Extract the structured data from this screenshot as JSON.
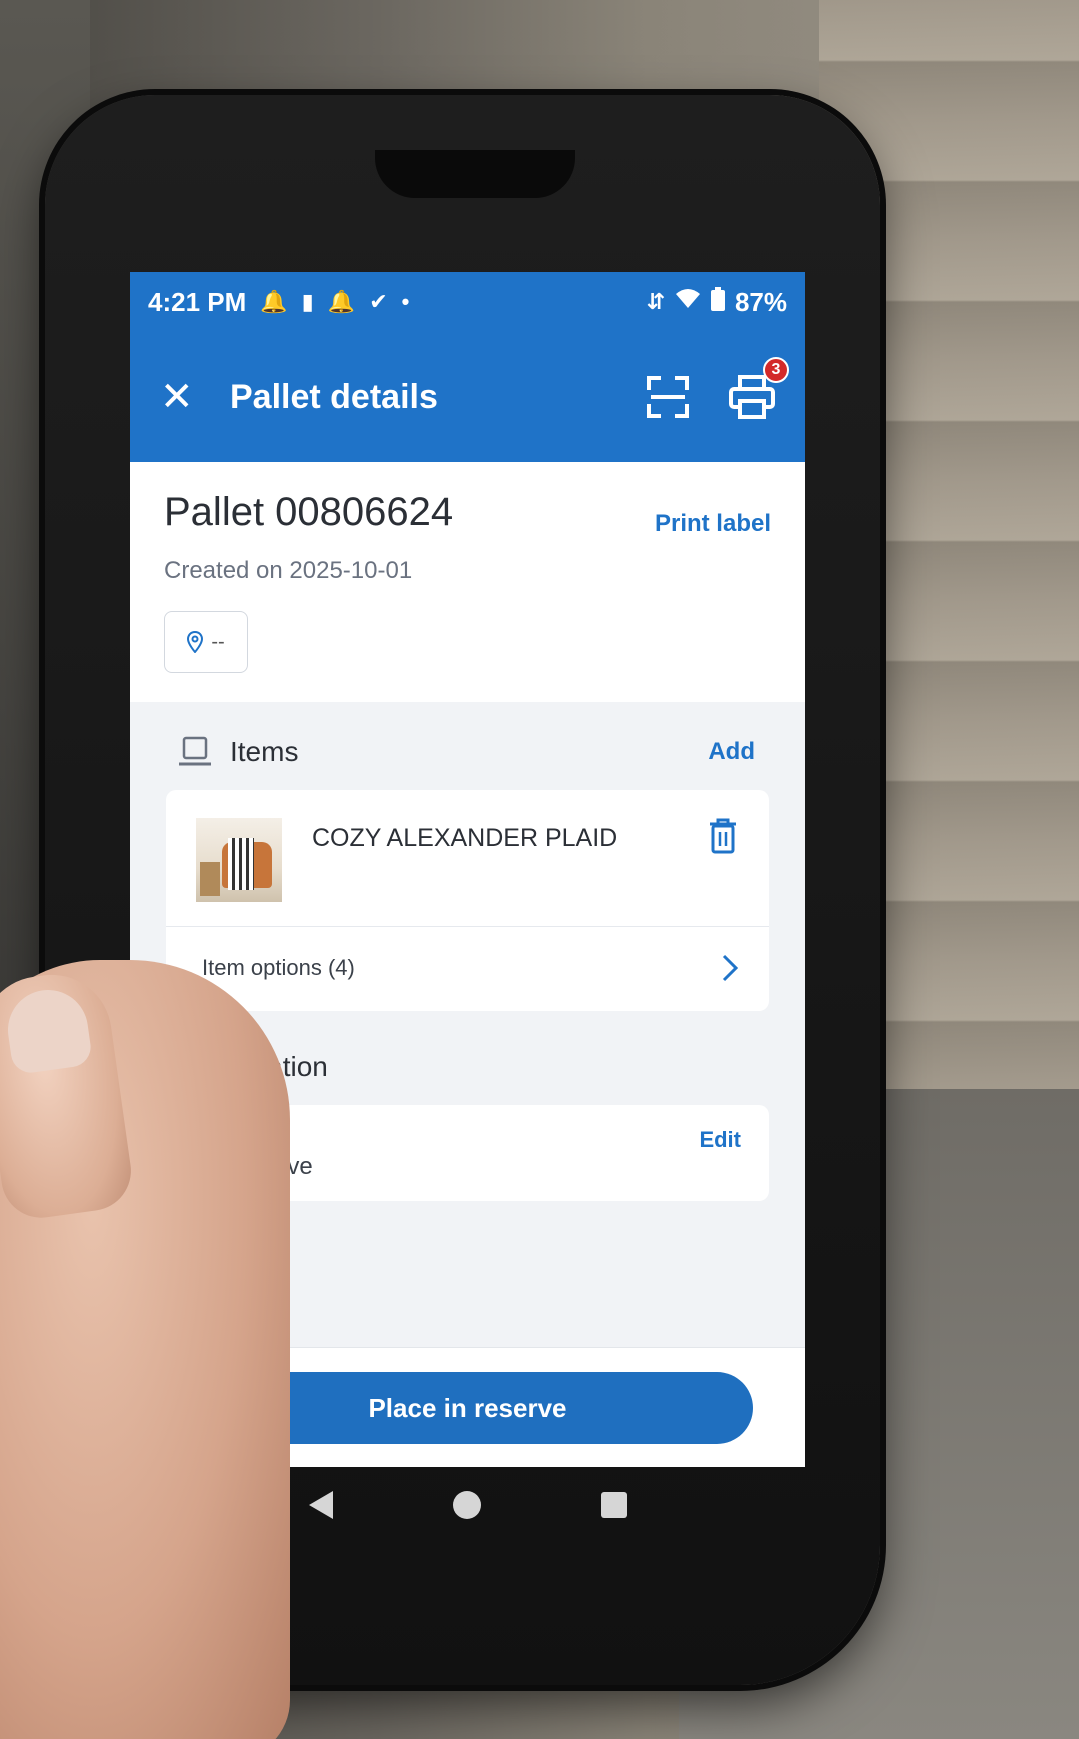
{
  "status_bar": {
    "time": "4:21 PM",
    "battery": "87%",
    "icons": [
      "alarm-icon",
      "sim-icon",
      "alarm-icon",
      "check-circle-icon",
      "dot-icon",
      "data-arrows-icon",
      "wifi-icon",
      "battery-icon"
    ]
  },
  "app_bar": {
    "title": "Pallet details",
    "printer_badge": "3"
  },
  "pallet": {
    "title": "Pallet 00806624",
    "print_label": "Print label",
    "created": "Created on 2025-10-01",
    "location_chip": "--"
  },
  "items": {
    "title": "Items",
    "add_label": "Add",
    "list": [
      {
        "name": "COZY ALEXANDER PLAID",
        "options_label": "Item options (4)"
      }
    ]
  },
  "location": {
    "title": "Location",
    "value": "- - Reserve",
    "edit_label": "Edit"
  },
  "actions": {
    "primary": "Place in reserve"
  },
  "colors": {
    "accent": "#1f73c8",
    "badge": "#d32a2a"
  }
}
